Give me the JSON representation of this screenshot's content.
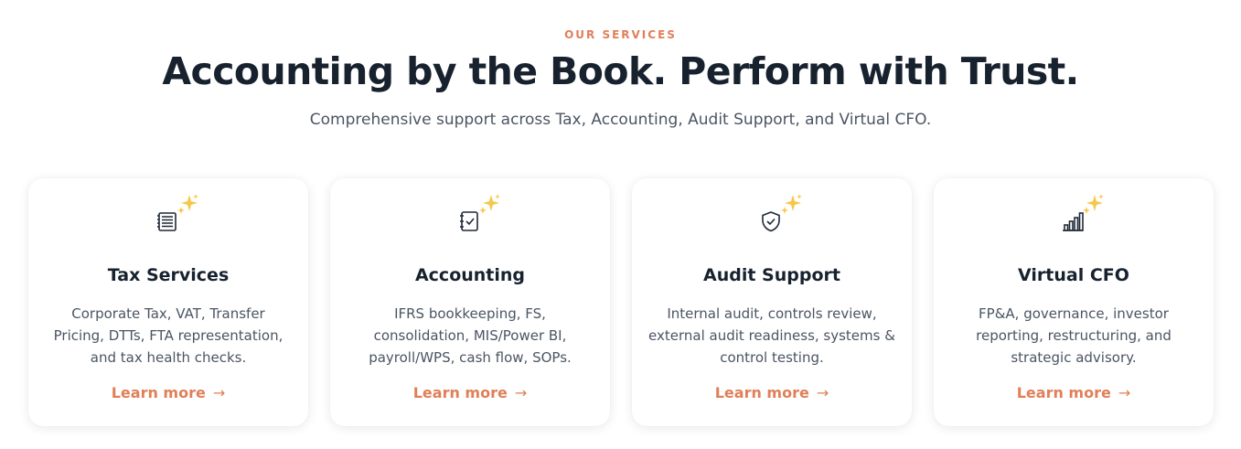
{
  "section": {
    "eyebrow": "OUR SERVICES",
    "headline": "Accounting by the Book. Perform with Trust.",
    "subhead": "Comprehensive support across Tax, Accounting, Audit Support, and Virtual CFO."
  },
  "cards": [
    {
      "icon": "tax-document-icon",
      "title": "Tax Services",
      "description": "Corporate Tax, VAT, Transfer Pricing, DTTs, FTA representation, and tax health checks.",
      "link_label": "Learn more",
      "link_arrow": "→"
    },
    {
      "icon": "notebook-check-icon",
      "title": "Accounting",
      "description": "IFRS bookkeeping, FS, consolidation, MIS/Power BI, payroll/WPS, cash flow, SOPs.",
      "link_label": "Learn more",
      "link_arrow": "→"
    },
    {
      "icon": "shield-check-icon",
      "title": "Audit Support",
      "description": "Internal audit, controls review, external audit readiness, systems & control testing.",
      "link_label": "Learn more",
      "link_arrow": "→"
    },
    {
      "icon": "bar-chart-icon",
      "title": "Virtual CFO",
      "description": "FP&A, governance, investor reporting, restructuring, and strategic advisory.",
      "link_label": "Learn more",
      "link_arrow": "→"
    }
  ],
  "colors": {
    "accent": "#e07f58",
    "heading": "#18222f",
    "body": "#4b5563",
    "sparkle": "#f5c84c"
  }
}
